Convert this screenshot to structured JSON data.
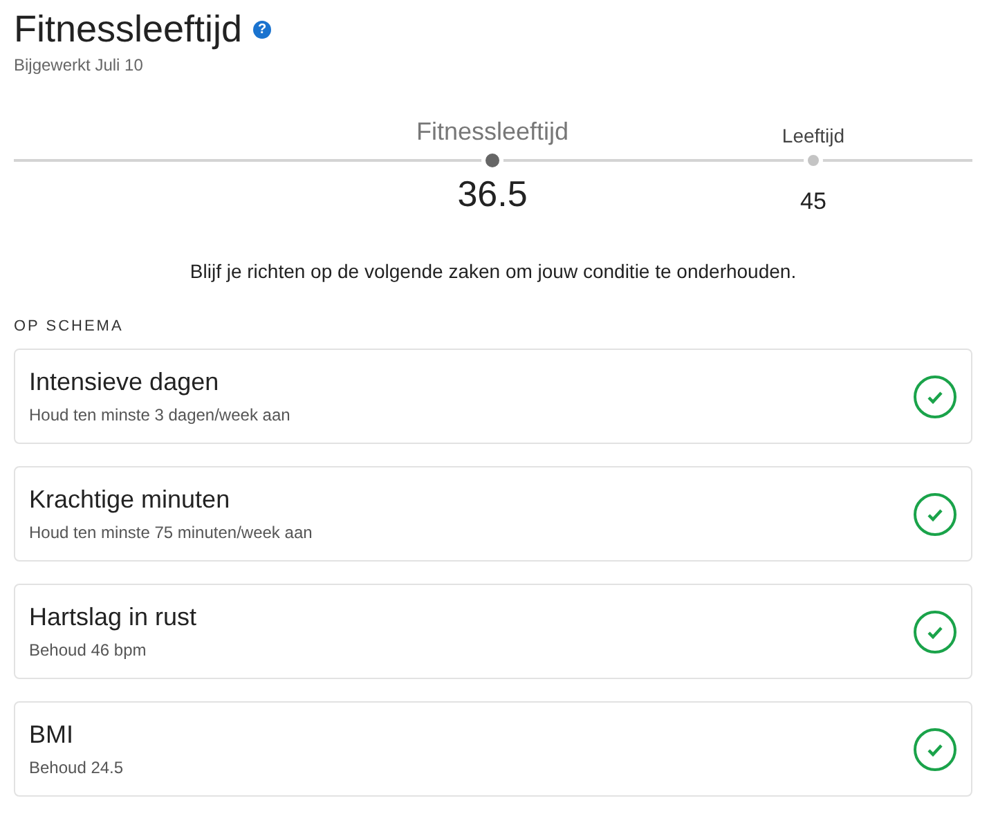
{
  "header": {
    "title": "Fitnessleeftijd",
    "help_icon": "?",
    "updated": "Bijgewerkt Juli 10"
  },
  "scale": [
    {
      "label": "Fitnessleeftijd",
      "value": "36.5",
      "kind": "primary"
    },
    {
      "label": "Leeftijd",
      "value": "45",
      "kind": "secondary"
    }
  ],
  "message": "Blijf je richten op de volgende zaken om jouw conditie te onderhouden.",
  "section": {
    "title": "OP SCHEMA",
    "items": [
      {
        "title": "Intensieve dagen",
        "subtitle": "Houd ten minste 3 dagen/week aan",
        "on_track": true
      },
      {
        "title": "Krachtige minuten",
        "subtitle": "Houd ten minste 75 minuten/week aan",
        "on_track": true
      },
      {
        "title": "Hartslag in rust",
        "subtitle": "Behoud 46 bpm",
        "on_track": true
      },
      {
        "title": "BMI",
        "subtitle": "Behoud 24.5",
        "on_track": true
      }
    ]
  }
}
